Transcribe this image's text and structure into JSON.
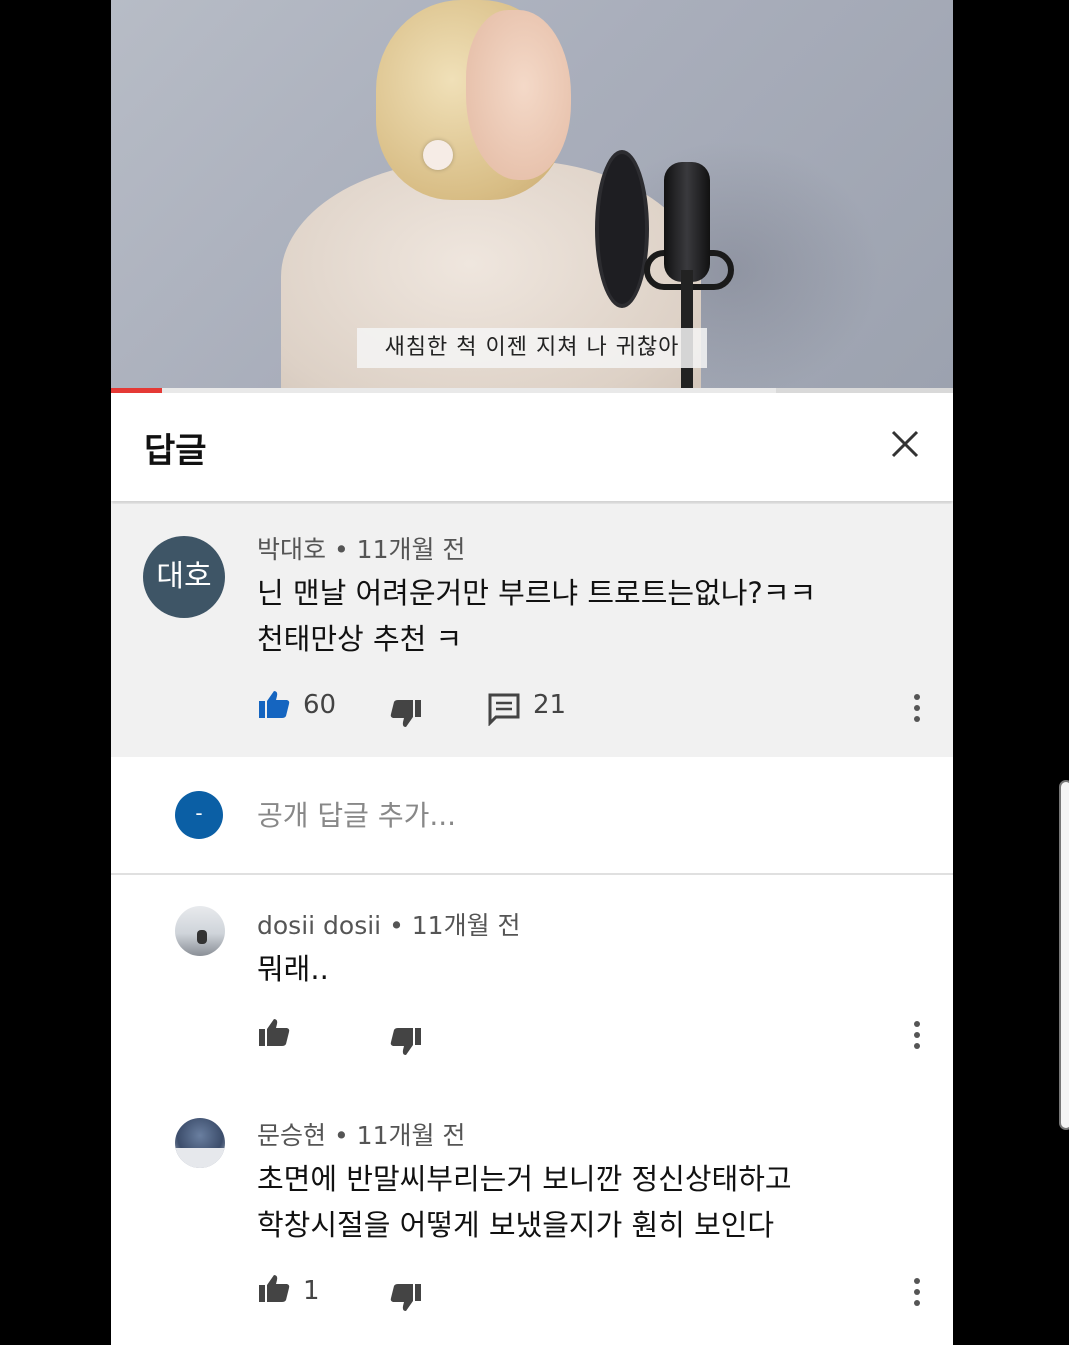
{
  "video": {
    "subtitle": "새침한 척 이젠 지쳐 나 귀찮아",
    "progress_fraction": 0.06,
    "buffered_fraction": 0.79
  },
  "header": {
    "title": "답글",
    "close_icon": "close-icon"
  },
  "main_comment": {
    "avatar_text": "대호",
    "avatar_color": "#3e5566",
    "author": "박대호",
    "time": "11개월 전",
    "lines": [
      "닌 맨날 어려운거만 부르냐 트로트는없나?ㅋㅋ",
      "천태만상 추천 ㅋ"
    ],
    "likes": "60",
    "replies": "21",
    "icons": [
      "thumb-up-icon",
      "thumb-down-icon",
      "reply-icon",
      "more-icon"
    ],
    "accent_color": "#1565c0"
  },
  "add_reply": {
    "avatar_text": "-",
    "placeholder": "공개 답글 추가...",
    "avatar_color": "#0b5fa5"
  },
  "replies": [
    {
      "author": "dosii dosii",
      "time": "11개월 전",
      "lines": [
        "뭐래.."
      ],
      "likes": ""
    },
    {
      "author": "문승현",
      "time": "11개월 전",
      "lines": [
        "초면에 반말씨부리는거 보니깐 정신상태하고",
        "학창시절을 어떻게 보냈을지가 훤히 보인다"
      ],
      "likes": "1"
    }
  ],
  "separator": "•"
}
